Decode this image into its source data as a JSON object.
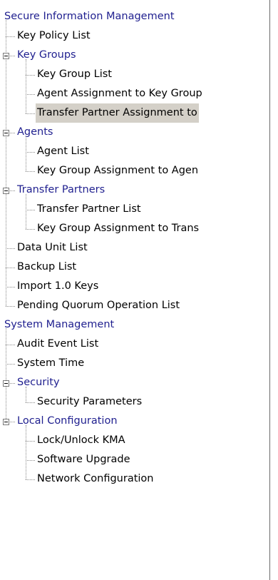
{
  "tree": {
    "nodes": [
      {
        "label": "Secure Information Management",
        "kind": "category"
      },
      {
        "label": "Key Policy List",
        "kind": "item"
      },
      {
        "label": "Key Groups",
        "kind": "category"
      },
      {
        "label": "Key Group List",
        "kind": "item"
      },
      {
        "label": "Agent Assignment to Key Group",
        "kind": "item"
      },
      {
        "label": "Transfer Partner Assignment to",
        "kind": "item",
        "selected": true
      },
      {
        "label": "Agents",
        "kind": "category"
      },
      {
        "label": "Agent List",
        "kind": "item"
      },
      {
        "label": "Key Group Assignment to Agen",
        "kind": "item"
      },
      {
        "label": "Transfer Partners",
        "kind": "category"
      },
      {
        "label": "Transfer Partner List",
        "kind": "item"
      },
      {
        "label": "Key Group Assignment to Trans",
        "kind": "item"
      },
      {
        "label": "Data Unit List",
        "kind": "item"
      },
      {
        "label": "Backup List",
        "kind": "item"
      },
      {
        "label": "Import 1.0 Keys",
        "kind": "item"
      },
      {
        "label": "Pending Quorum Operation List",
        "kind": "item"
      },
      {
        "label": "System Management",
        "kind": "category"
      },
      {
        "label": "Audit Event List",
        "kind": "item"
      },
      {
        "label": "System Time",
        "kind": "item"
      },
      {
        "label": "Security",
        "kind": "category"
      },
      {
        "label": "Security Parameters",
        "kind": "item"
      },
      {
        "label": "Local Configuration",
        "kind": "category"
      },
      {
        "label": "Lock/Unlock KMA",
        "kind": "item"
      },
      {
        "label": "Software Upgrade",
        "kind": "item"
      },
      {
        "label": "Network Configuration",
        "kind": "item"
      }
    ]
  },
  "colors": {
    "category_text": "#1f1f8f",
    "item_text": "#000000",
    "selected_background": "#d4d0c8",
    "tree_lines": "#8a8a8a"
  }
}
